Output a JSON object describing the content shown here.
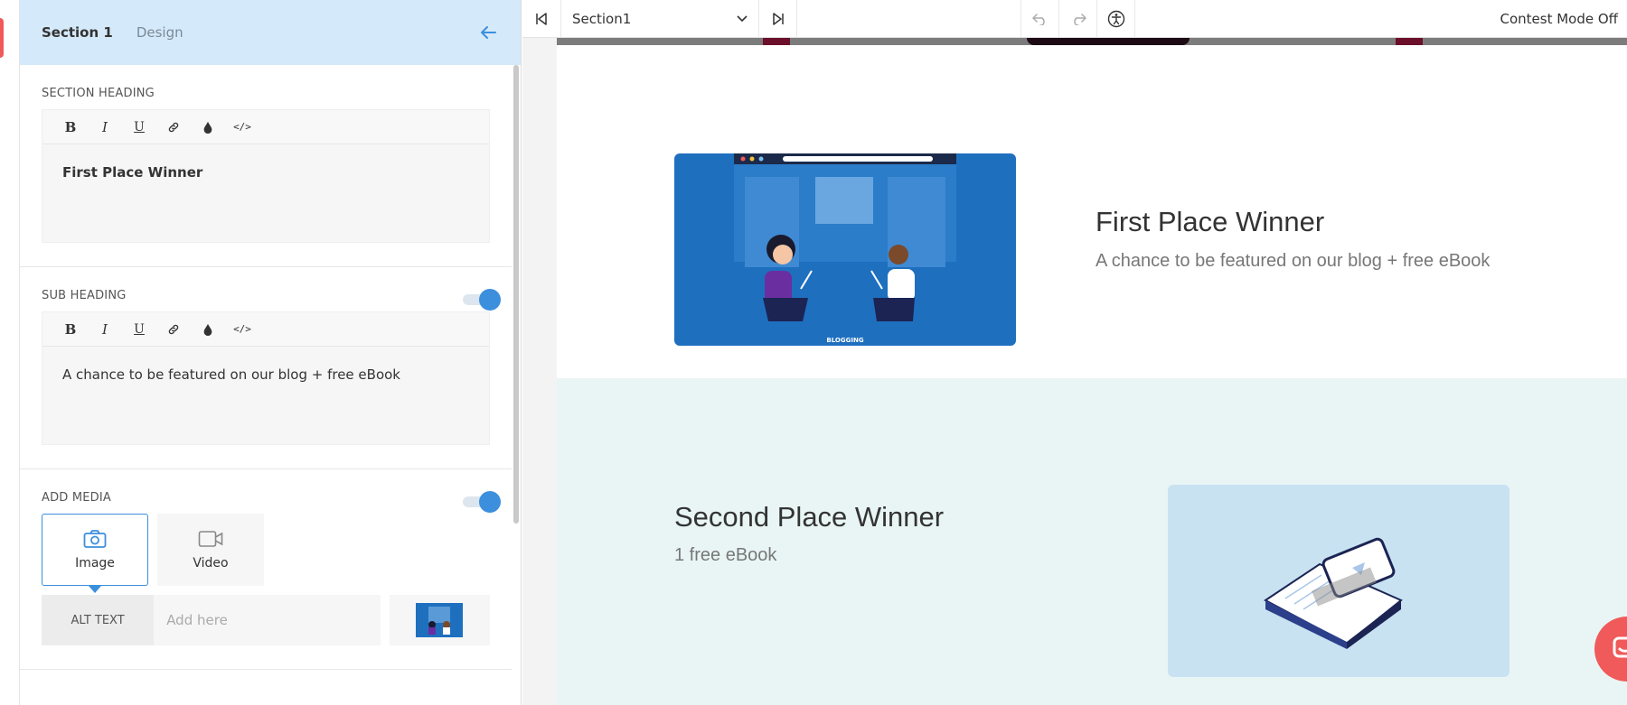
{
  "panel": {
    "tabs": [
      {
        "label": "Section 1",
        "active": true
      },
      {
        "label": "Design",
        "active": false
      }
    ],
    "section_heading": {
      "label": "SECTION HEADING",
      "text": "First Place Winner"
    },
    "sub_heading": {
      "label": "SUB HEADING",
      "enabled": true,
      "text": "A chance to be featured on our blog + free eBook"
    },
    "add_media": {
      "label": "ADD MEDIA",
      "enabled": true,
      "options": [
        {
          "label": "Image",
          "icon": "camera-icon",
          "selected": true
        },
        {
          "label": "Video",
          "icon": "video-icon",
          "selected": false
        }
      ],
      "alt_text_label": "ALT TEXT",
      "alt_text_placeholder": "Add here"
    },
    "toolbar_icons": [
      "bold-icon",
      "italic-icon",
      "underline-icon",
      "link-icon",
      "color-drop-icon",
      "code-icon"
    ]
  },
  "topbar": {
    "section_select": "Section1",
    "contest_mode": "Contest Mode Off"
  },
  "preview": {
    "prize1": {
      "title": "First Place Winner",
      "subtitle": "A chance to be featured on our blog + free eBook",
      "image_caption": "BLOGGING"
    },
    "prize2": {
      "title": "Second Place Winner",
      "subtitle": "1 free eBook"
    }
  },
  "colors": {
    "accent": "#3c8fdd",
    "header_bg": "#d4e9f9",
    "prize2_bg": "#e9f5f5",
    "brand_red": "#f05a5a"
  }
}
